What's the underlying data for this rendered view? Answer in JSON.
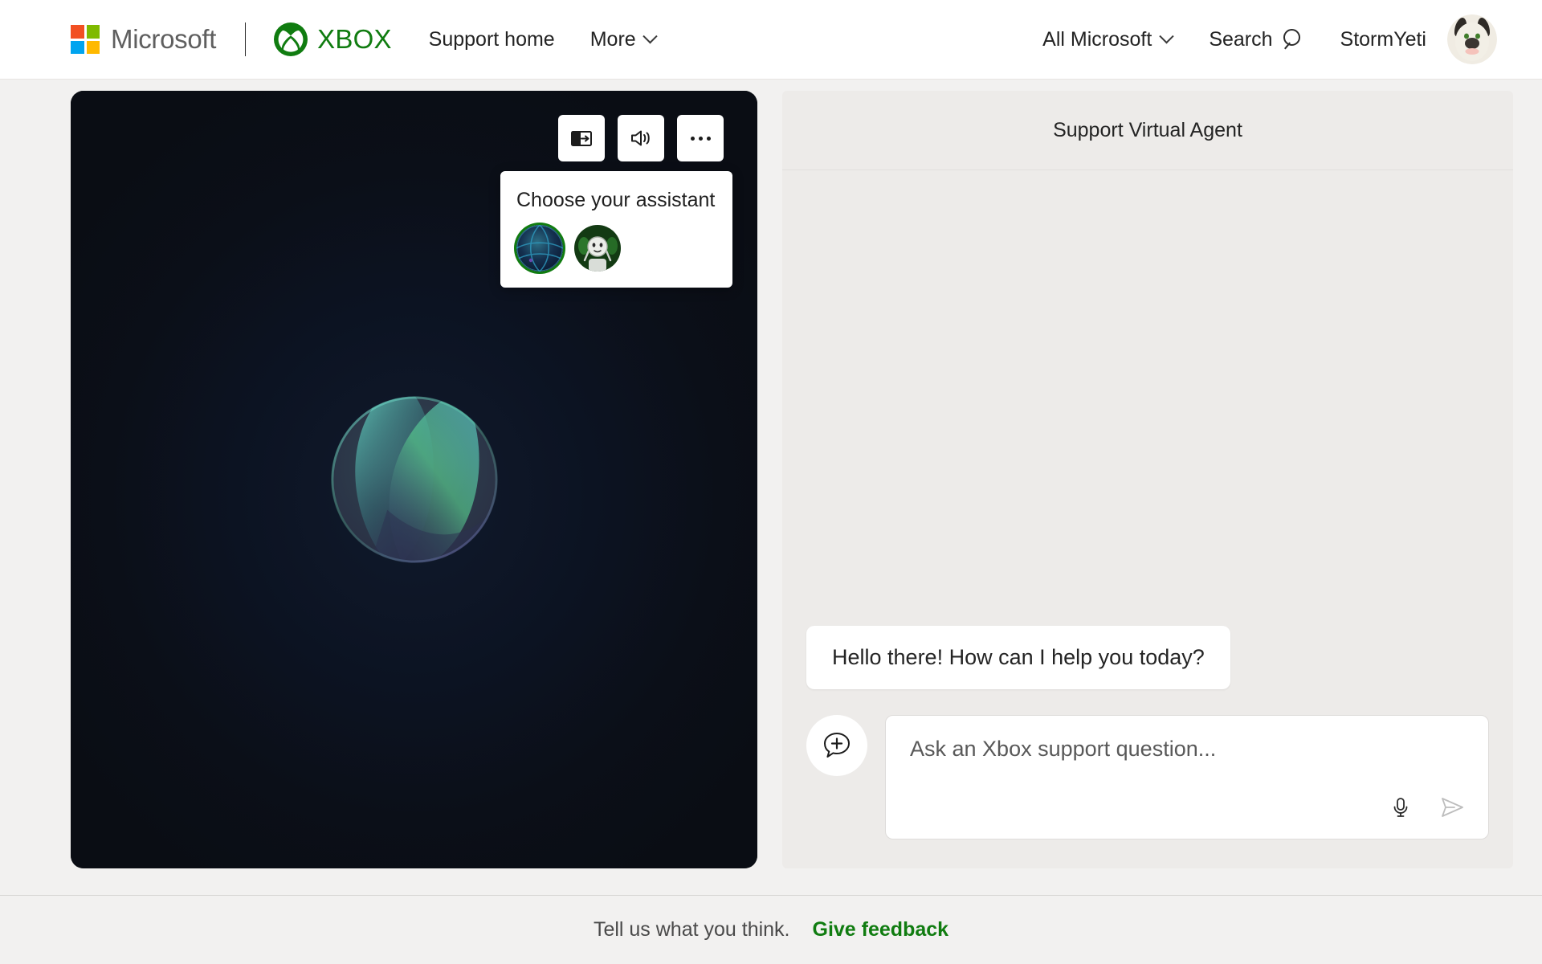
{
  "header": {
    "microsoft_wordmark": "Microsoft",
    "microsoft_logo_colors": {
      "red": "#F25022",
      "green": "#7FBA00",
      "blue": "#00A4EF",
      "yellow": "#FFB900"
    },
    "xbox_wordmark": "XBOX",
    "xbox_green": "#107C10",
    "nav": [
      {
        "label": "Support home",
        "has_chevron": false
      },
      {
        "label": "More",
        "has_chevron": true
      }
    ],
    "right": [
      {
        "label": "All Microsoft",
        "has_chevron": true
      },
      {
        "label": "Search",
        "icon": "search-icon"
      }
    ],
    "user_name": "StormYeti",
    "avatar_icon": "user-avatar"
  },
  "stage": {
    "toolbar": [
      {
        "name": "picture-in-picture-icon",
        "label": "Picture in picture"
      },
      {
        "name": "volume-icon",
        "label": "Volume"
      },
      {
        "name": "more-options-icon",
        "label": "More options"
      }
    ],
    "orb_label": "assistant-orb"
  },
  "chooser": {
    "title": "Choose your assistant",
    "assistants": [
      {
        "name": "assistant-option-orb",
        "selected": true
      },
      {
        "name": "assistant-option-robot",
        "selected": false
      }
    ],
    "selection_ring_color": "#107C10"
  },
  "chat": {
    "title": "Support Virtual Agent",
    "messages": [
      {
        "from": "agent",
        "text": "Hello there! How can I help you today?"
      }
    ],
    "composer": {
      "add_button_icon": "chat-plus-icon",
      "input_value": "",
      "placeholder": "Ask an Xbox support question...",
      "mic_icon": "microphone-icon",
      "send_icon": "send-icon",
      "send_enabled": false
    }
  },
  "footer": {
    "text": "Tell us what you think.",
    "link": "Give feedback",
    "link_color": "#107C10"
  }
}
